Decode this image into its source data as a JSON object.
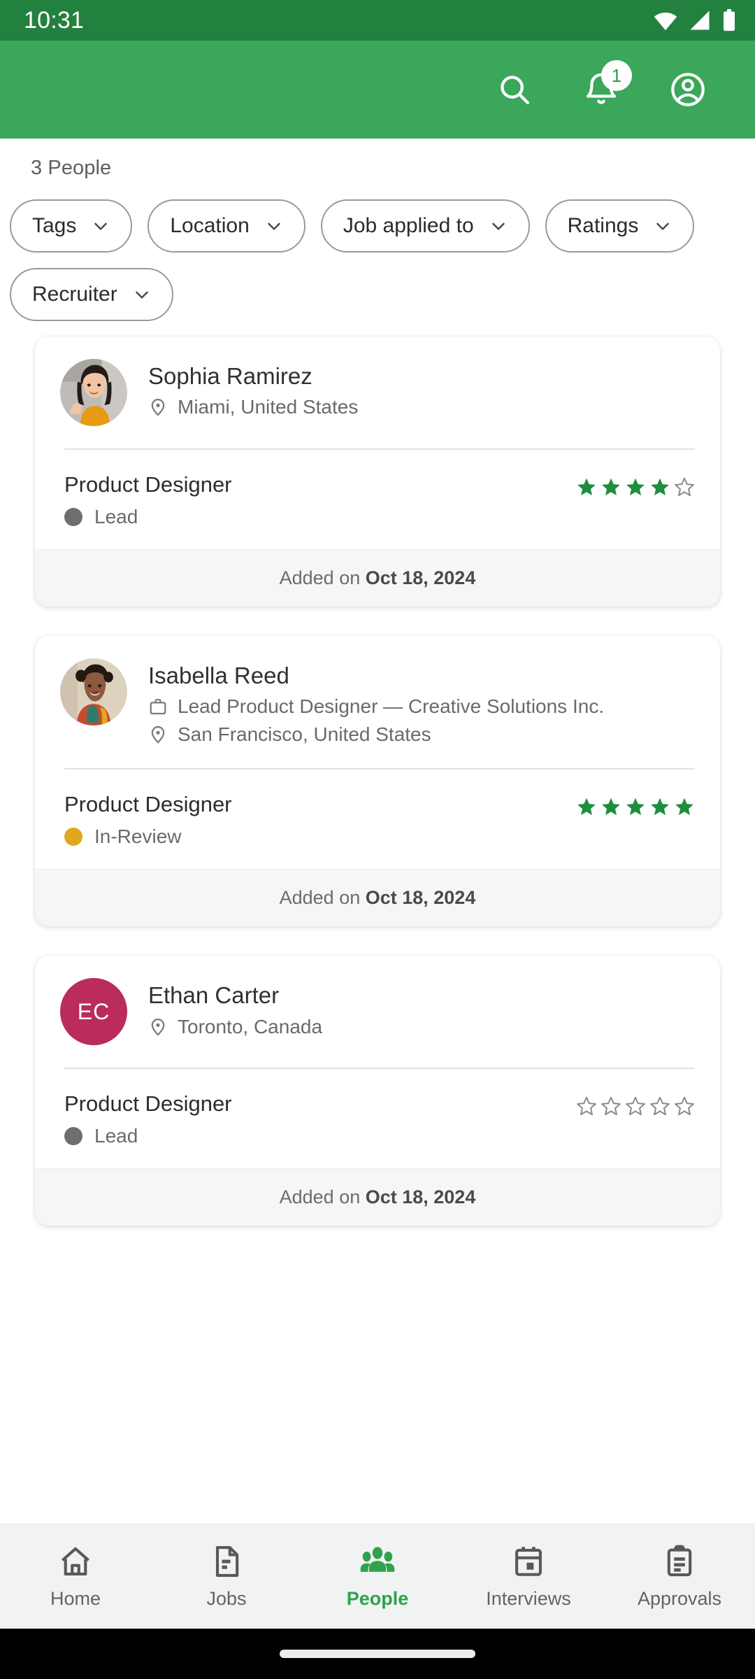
{
  "status_bar": {
    "time": "10:31",
    "icons": [
      "wifi-icon",
      "cellular-signal-icon",
      "battery-icon"
    ]
  },
  "app_bar": {
    "background_color": "#3BA75A",
    "actions": [
      {
        "name": "search-icon",
        "label": "Search"
      },
      {
        "name": "notifications-icon",
        "label": "Notifications",
        "badge": "1"
      },
      {
        "name": "account-circle-icon",
        "label": "Account"
      }
    ]
  },
  "header": {
    "count_label": "3 People"
  },
  "filters": [
    {
      "label": "Tags",
      "icon": "chevron-down-icon"
    },
    {
      "label": "Location",
      "icon": "chevron-down-icon"
    },
    {
      "label": "Job applied to",
      "icon": "chevron-down-icon"
    },
    {
      "label": "Ratings",
      "icon": "chevron-down-icon"
    },
    {
      "label": "Recruiter",
      "icon": "chevron-down-icon"
    }
  ],
  "people": [
    {
      "name": "Sophia Ramirez",
      "avatar_type": "photo",
      "avatar_initials": "",
      "avatar_color": "#C9C4BE",
      "headline": "",
      "location": "Miami, United States",
      "role": "Product Designer",
      "stage": "Lead",
      "stage_color": "#6E6E6E",
      "rating": 4,
      "rating_max": 5,
      "added_prefix": "Added on ",
      "added_date": "Oct 18, 2024"
    },
    {
      "name": "Isabella Reed",
      "avatar_type": "photo",
      "avatar_initials": "",
      "avatar_color": "#D9CDBC",
      "headline": "Lead Product Designer — Creative Solutions Inc.",
      "location": "San Francisco, United States",
      "role": "Product Designer",
      "stage": "In-Review",
      "stage_color": "#E0A81C",
      "rating": 5,
      "rating_max": 5,
      "added_prefix": "Added on ",
      "added_date": "Oct 18, 2024"
    },
    {
      "name": "Ethan Carter",
      "avatar_type": "initials",
      "avatar_initials": "EC",
      "avatar_color": "#B92C5D",
      "headline": "",
      "location": "Toronto, Canada",
      "role": "Product Designer",
      "stage": "Lead",
      "stage_color": "#6E6E6E",
      "rating": 0,
      "rating_max": 5,
      "added_prefix": "Added on ",
      "added_date": "Oct 18, 2024"
    }
  ],
  "bottom_nav": {
    "active_color": "#2FA24D",
    "items": [
      {
        "label": "Home",
        "icon": "home-icon",
        "active": false
      },
      {
        "label": "Jobs",
        "icon": "document-icon",
        "active": false
      },
      {
        "label": "People",
        "icon": "people-group-icon",
        "active": true
      },
      {
        "label": "Interviews",
        "icon": "calendar-icon",
        "active": false
      },
      {
        "label": "Approvals",
        "icon": "clipboard-icon",
        "active": false
      }
    ]
  },
  "colors": {
    "status_bar": "#23813F",
    "app_bar": "#3BA75A",
    "star_filled": "#1E8E3E",
    "star_empty": "#8A8A8A",
    "card_footer_bg": "#F5F6F5",
    "nav_bg": "#F1F3F2"
  }
}
